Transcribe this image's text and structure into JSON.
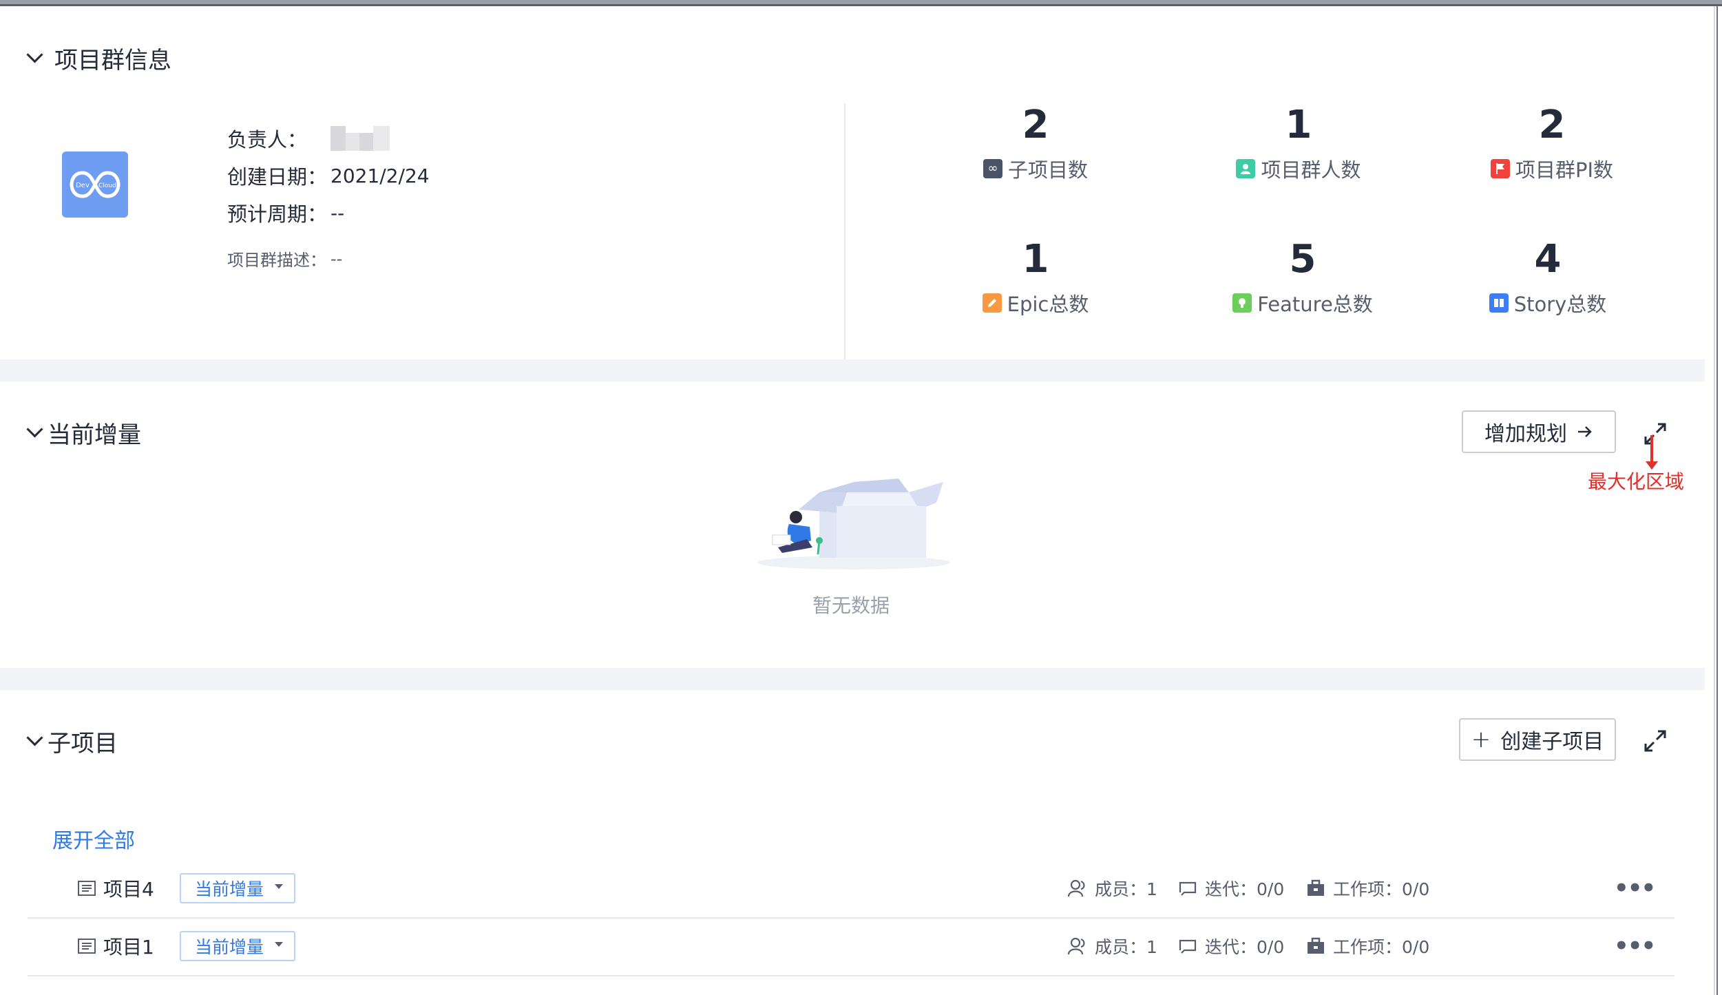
{
  "sections": {
    "info_title": "项目群信息",
    "increment_title": "当前增量",
    "subprojects_title": "子项目"
  },
  "info": {
    "owner_label": "负责人：",
    "created_label": "创建日期：",
    "created_value": "2021/2/24",
    "period_label": "预计周期：",
    "period_value": "--",
    "desc_label": "项目群描述：",
    "desc_value": "--"
  },
  "stats": [
    {
      "value": "2",
      "label": "子项目数",
      "icon": "infinity-icon",
      "color": "#4a5466"
    },
    {
      "value": "1",
      "label": "项目群人数",
      "icon": "person-icon",
      "color": "#3dcca6"
    },
    {
      "value": "2",
      "label": "项目群PI数",
      "icon": "flag-icon",
      "color": "#f0433d"
    },
    {
      "value": "1",
      "label": "Epic总数",
      "icon": "pencil-icon",
      "color": "#fa9841"
    },
    {
      "value": "5",
      "label": "Feature总数",
      "icon": "bulb-icon",
      "color": "#6ccf5c"
    },
    {
      "value": "4",
      "label": "Story总数",
      "icon": "book-icon",
      "color": "#3d7ef5"
    }
  ],
  "increment": {
    "add_plan_label": "增加规划",
    "empty_text": "暂无数据",
    "annotation": "最大化区域",
    "annotation_color": "#e0302b"
  },
  "subprojects": {
    "create_label": "创建子项目",
    "expand_all": "展开全部",
    "rows": [
      {
        "name": "项目4",
        "tag": "当前增量",
        "members": "成员：1",
        "iterations": "迭代：0/0",
        "workitems": "工作项：0/0"
      },
      {
        "name": "项目1",
        "tag": "当前增量",
        "members": "成员：1",
        "iterations": "迭代：0/0",
        "workitems": "工作项：0/0"
      }
    ]
  },
  "colors": {
    "accent": "#2f7ae5",
    "text": "#252b3a",
    "band": "#f2f4f7"
  }
}
